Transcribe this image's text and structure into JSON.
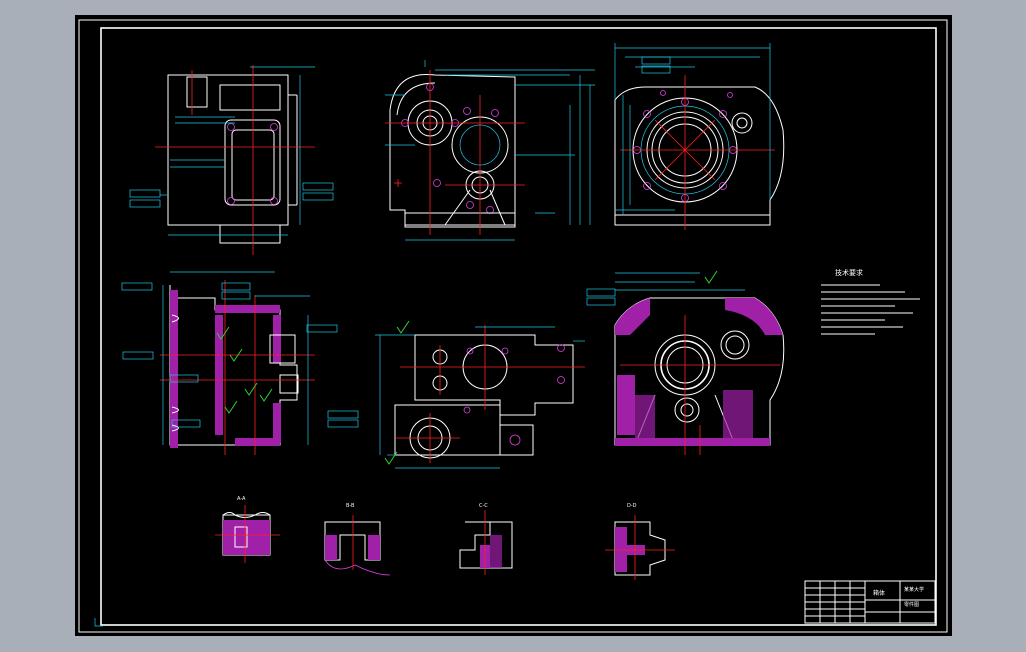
{
  "drawing": {
    "accent_colors": {
      "outline": "#ffffff",
      "dimension": "#1ec8e6",
      "centerline": "#ff2020",
      "hatch": "#a020a8",
      "roughness": "#30d030",
      "background": "#000000"
    },
    "tech_requirements_title": "技术要求",
    "section_labels": [
      "A-A",
      "B-B",
      "C-C",
      "D-D"
    ],
    "title_block": {
      "part_name": "箱体",
      "school": "某某大学",
      "drawing_type": "零件图"
    }
  }
}
